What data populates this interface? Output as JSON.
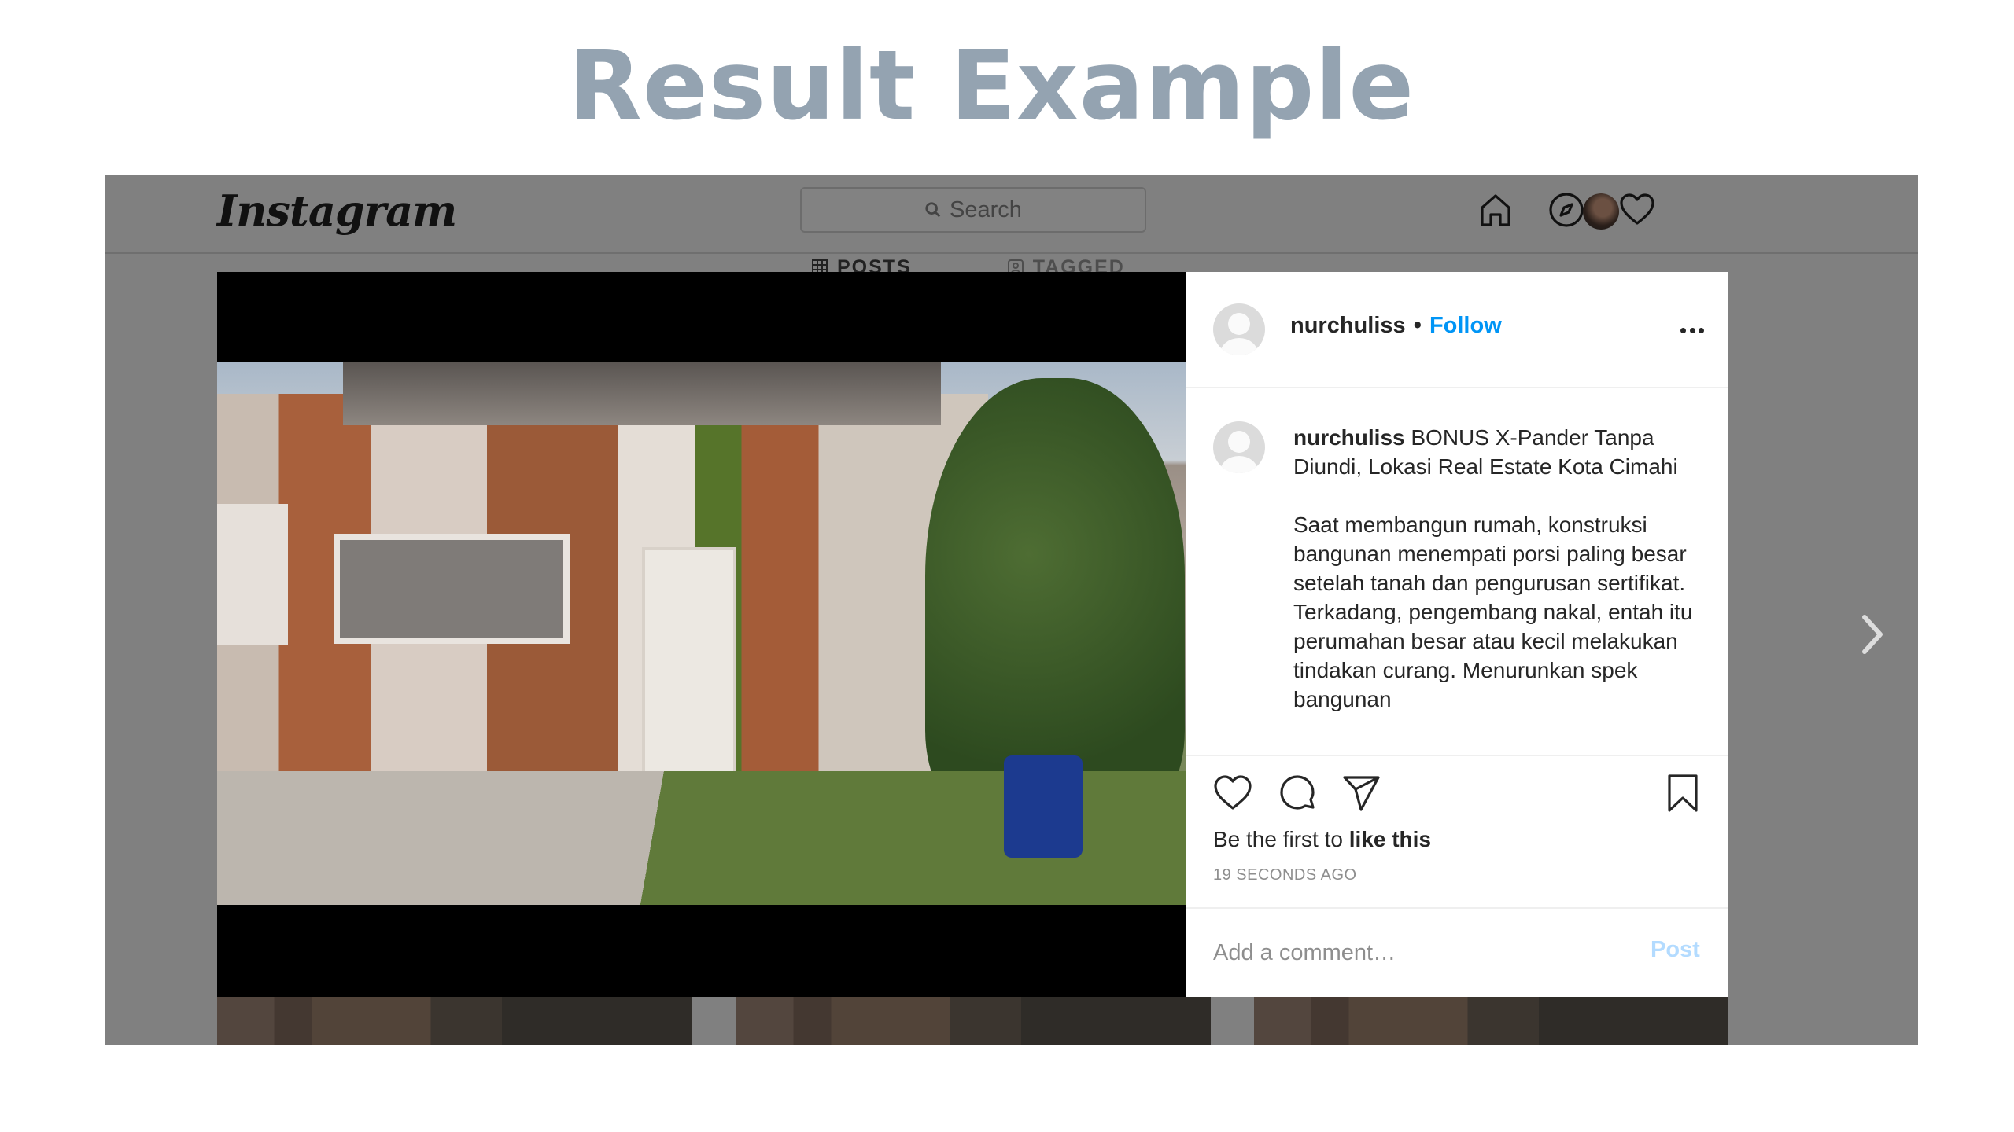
{
  "slide": {
    "title": "Result Example"
  },
  "instagram": {
    "logo": "Instagram",
    "search": {
      "placeholder": "Search"
    },
    "profile_tabs": [
      {
        "label": "POSTS",
        "icon": "grid-icon"
      },
      {
        "label": "TAGGED",
        "icon": "tag-icon"
      }
    ]
  },
  "post": {
    "username": "nurchuliss",
    "separator": "•",
    "follow_label": "Follow",
    "caption_username": "nurchuliss",
    "caption": " BONUS X-Pander Tanpa Diundi, Lokasi Real Estate Kota Cimahi\n\nSaat membangun rumah, konstruksi bangunan menempati porsi paling besar setelah tanah dan pengurusan sertifikat. Terkadang, pengembang nakal, entah itu perumahan besar atau kecil melakukan tindakan curang. Menurunkan spek bangunan",
    "likes_prefix": "Be the first to ",
    "likes_bold": "like this",
    "timestamp": "19 SECONDS AGO",
    "comment_placeholder": "Add a comment…",
    "post_label": "Post"
  },
  "colors": {
    "follow": "#0095f6",
    "post_button_disabled": "#b3dbff",
    "overlay": "#808080",
    "title": "#94a3b1"
  }
}
